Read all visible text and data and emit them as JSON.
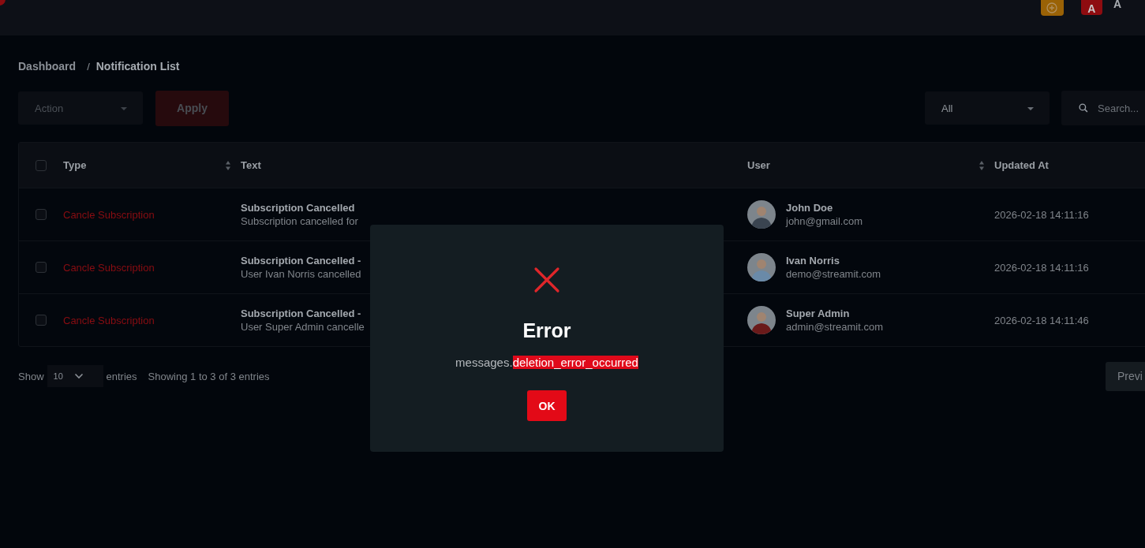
{
  "header": {
    "avatar_letter": "A",
    "user_initial": "A"
  },
  "breadcrumb": {
    "items": [
      "Dashboard",
      "Notification List"
    ],
    "separator": "/"
  },
  "toolbar": {
    "action_select": "Action",
    "apply_button": "Apply",
    "filter_select": "All",
    "search": {
      "placeholder": "Search..."
    }
  },
  "table": {
    "select_all_checked": false,
    "columns": [
      {
        "label": "Type",
        "sortable": true
      },
      {
        "label": "Text",
        "sortable": false
      },
      {
        "label": "User",
        "sortable": true
      },
      {
        "label": "Updated At",
        "sortable": false
      }
    ],
    "rows": [
      {
        "checked": false,
        "type": "Cancle Subscription",
        "title": "Subscription Cancelled",
        "text": "Subscription cancelled for",
        "user": "John Doe",
        "email": "john@gmail.com",
        "updated": "2026-02-18 14:11:16"
      },
      {
        "checked": false,
        "type": "Cancle Subscription",
        "title": "Subscription Cancelled -",
        "text": "User Ivan Norris cancelled",
        "user": "Ivan Norris",
        "email": "demo@streamit.com",
        "updated": "2026-02-18 14:11:16"
      },
      {
        "checked": false,
        "type": "Cancle Subscription",
        "title": "Subscription Cancelled -",
        "text": "User Super Admin cancelle",
        "user": "Super Admin",
        "email": "admin@streamit.com",
        "updated": "2026-02-18 14:11:46"
      }
    ]
  },
  "footer": {
    "show_label": "Show",
    "page_size": "10",
    "entries_label": "entries",
    "info": "Showing 1 to 3 of 3 entries",
    "prev_button": "Previ"
  },
  "dialog": {
    "title": "Error",
    "message_prefix": "messages.",
    "message_highlight": "deletion_error_occurred",
    "ok_button": "OK"
  }
}
